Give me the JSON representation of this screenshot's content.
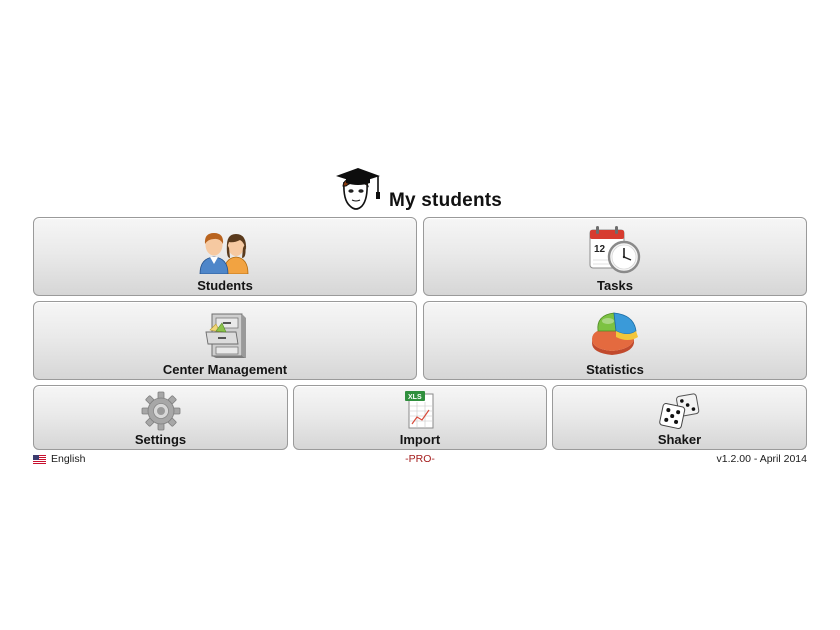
{
  "app": {
    "title": "My students"
  },
  "tiles": [
    {
      "id": "students",
      "label": "Students",
      "icon": "students-icon"
    },
    {
      "id": "tasks",
      "label": "Tasks",
      "icon": "calendar-clock-icon",
      "calendar_day": "12"
    },
    {
      "id": "center_management",
      "label": "Center Management",
      "icon": "file-cabinet-icon"
    },
    {
      "id": "statistics",
      "label": "Statistics",
      "icon": "pie-chart-icon"
    },
    {
      "id": "settings",
      "label": "Settings",
      "icon": "gear-icon"
    },
    {
      "id": "import",
      "label": "Import",
      "icon": "xls-spreadsheet-icon",
      "icon_badge": "XLS"
    },
    {
      "id": "shaker",
      "label": "Shaker",
      "icon": "dice-icon"
    }
  ],
  "footer": {
    "language": "English",
    "language_icon": "us-flag-icon",
    "edition": "-PRO-",
    "version": "v1.2.00 - April 2014"
  },
  "colors": {
    "tile_top": "#f6f6f6",
    "tile_bottom": "#d6d6d6",
    "tile_border": "#9a9a9a",
    "edition_text": "#a41d1d"
  }
}
